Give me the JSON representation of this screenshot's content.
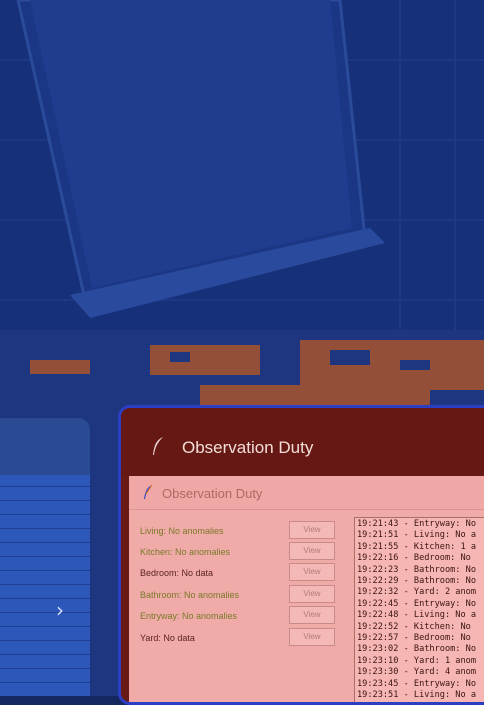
{
  "colors": {
    "accent_border": "#2a3fc4",
    "window_bg": "#f0aaa8",
    "ok_text": "#7a7a2a",
    "nodata_text": "#5a2420"
  },
  "card": {
    "title": "Observation Duty",
    "icon": "feather-icon"
  },
  "window": {
    "title": "Observation Duty",
    "icon": "feather-icon"
  },
  "rooms": [
    {
      "label": "Living: No anomalies",
      "button": "View",
      "status": "ok"
    },
    {
      "label": "Kitchen: No anomalies",
      "button": "View",
      "status": "ok"
    },
    {
      "label": "Bedroom: No data",
      "button": "View",
      "status": "nodata"
    },
    {
      "label": "Bathroom: No anomalies",
      "button": "View",
      "status": "ok"
    },
    {
      "label": "Entryway: No anomalies",
      "button": "View",
      "status": "ok"
    },
    {
      "label": "Yard: No data",
      "button": "View",
      "status": "nodata"
    }
  ],
  "log": [
    "19:21:43 - Entryway: No",
    "19:21:51 - Living: No a",
    "19:21:55 - Kitchen: 1 a",
    "19:22:16 - Bedroom: No",
    "19:22:23 - Bathroom: No",
    "19:22:29 - Bathroom: No",
    "19:22:32 - Yard: 2 anom",
    "19:22:45 - Entryway: No",
    "19:22:48 - Living: No a",
    "19:22:52 - Kitchen: No",
    "19:22:57 - Bedroom: No",
    "19:23:02 - Bathroom: No",
    "19:23:10 - Yard: 1 anom",
    "19:23:30 - Yard: 4 anom",
    "19:23:45 - Entryway: No",
    "19:23:51 - Living: No a"
  ],
  "side": {
    "chevron": "›",
    "icon": "chevron-right-icon"
  }
}
